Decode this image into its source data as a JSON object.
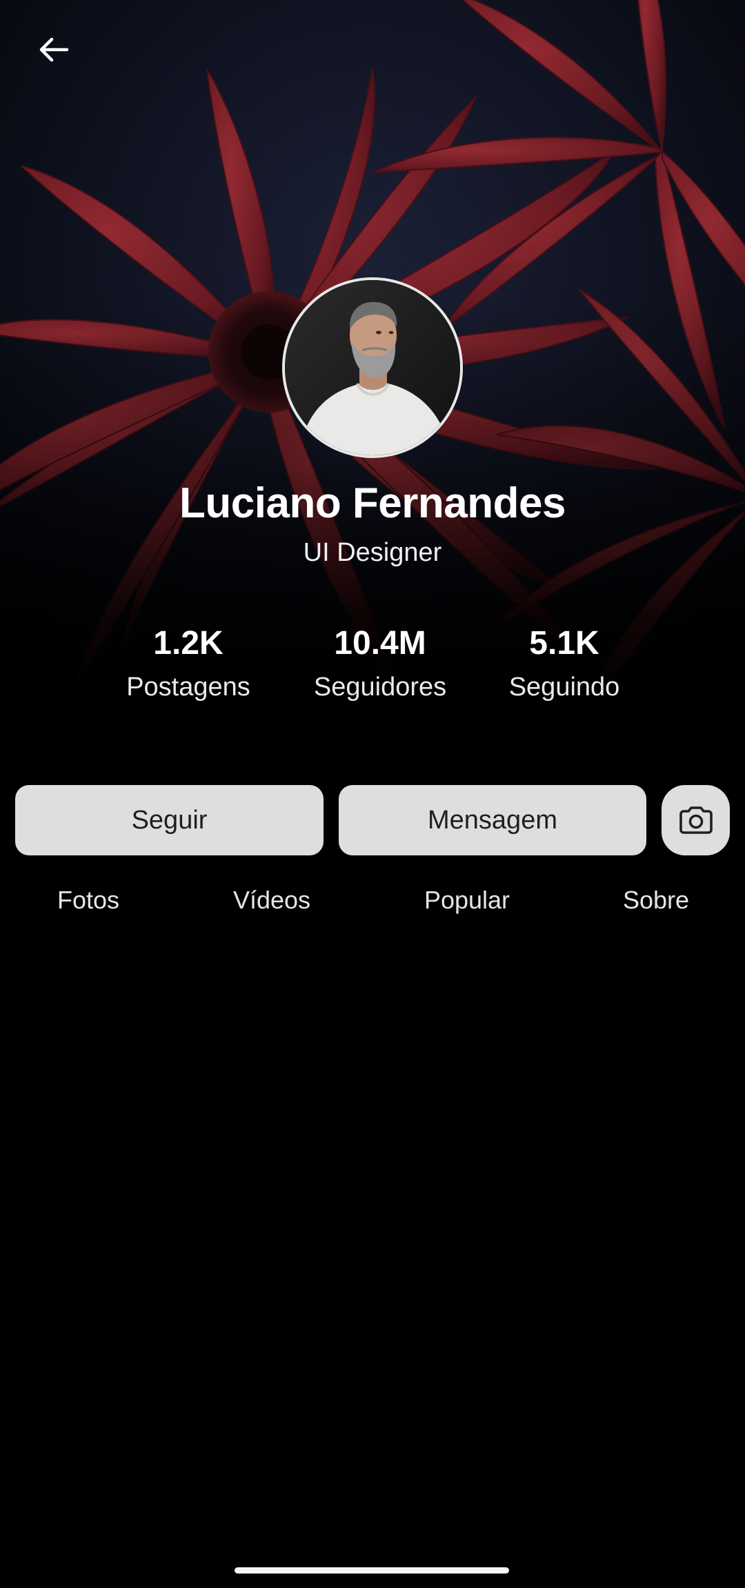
{
  "colors": {
    "background": "#000000",
    "button_bg": "#dedede",
    "button_text": "#1f1f1f",
    "cover_flower": "#7a1f26",
    "cover_bg": "#0b0d17"
  },
  "header": {
    "back_icon": "arrow-left-icon"
  },
  "profile": {
    "name": "Luciano Fernandes",
    "role": "UI Designer",
    "avatar": "profile-photo"
  },
  "stats": [
    {
      "value": "1.2K",
      "label": "Postagens"
    },
    {
      "value": "10.4M",
      "label": "Seguidores"
    },
    {
      "value": "5.1K",
      "label": "Seguindo"
    }
  ],
  "actions": {
    "follow_label": "Seguir",
    "message_label": "Mensagem",
    "camera_icon": "camera-icon"
  },
  "tabs": [
    {
      "label": "Fotos"
    },
    {
      "label": "Vídeos"
    },
    {
      "label": "Popular"
    },
    {
      "label": "Sobre"
    }
  ]
}
